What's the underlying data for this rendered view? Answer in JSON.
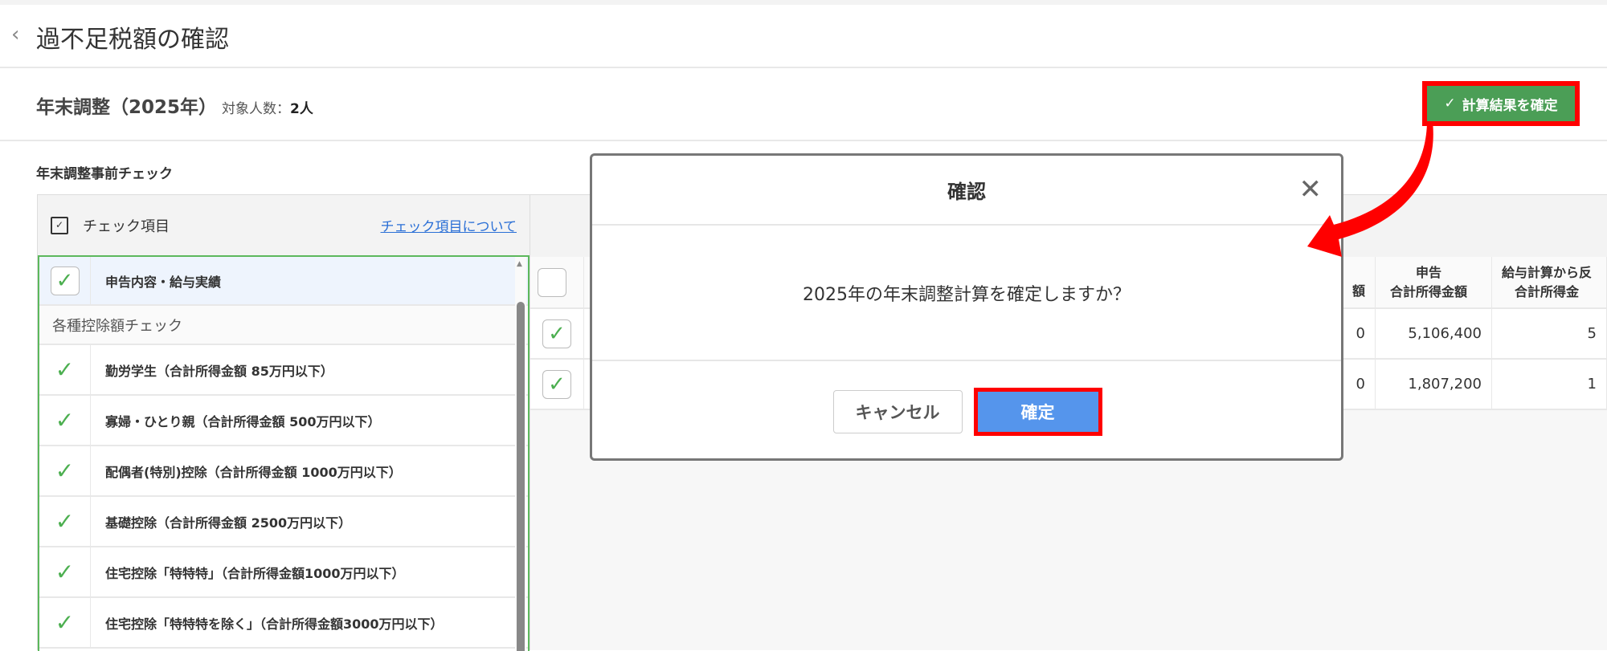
{
  "header": {
    "title": "過不足税額の確認",
    "back_icon": "chevron-left-icon"
  },
  "subheader": {
    "title": "年末調整（2025年）",
    "count_label": "対象人数：",
    "count_value": "2人",
    "confirm_button": "計算結果を確定"
  },
  "precheck": {
    "section_title": "年末調整事前チェック",
    "panel_title": "チェック項目",
    "about_link": "チェック項目について",
    "first_item": "申告内容・給与実績",
    "group_label": "各種控除額チェック",
    "items": [
      "勤労学生（合計所得金額 85万円以下）",
      "寡婦・ひとり親（合計所得金額 500万円以下）",
      "配偶者(特別)控除（合計所得金額 1000万円以下）",
      "基礎控除（合計所得金額 2500万円以下）",
      "住宅控除「特特特」（合計所得金額1000万円以下）",
      "住宅控除「特特特を除く」（合計所得金額3000万円以下）"
    ]
  },
  "table": {
    "headers": [
      "額",
      "申告\n合計所得金額",
      "給与計算から反\n合計所得金"
    ],
    "rows": [
      [
        "0",
        "5,106,400",
        "5"
      ],
      [
        "0",
        "1,807,200",
        "1"
      ]
    ]
  },
  "modal": {
    "title": "確認",
    "message": "2025年の年末調整計算を確定しますか？",
    "cancel": "キャンセル",
    "confirm": "確定"
  },
  "colors": {
    "green": "#4b9e56",
    "blue": "#5595ec",
    "highlight": "#ff0000"
  }
}
